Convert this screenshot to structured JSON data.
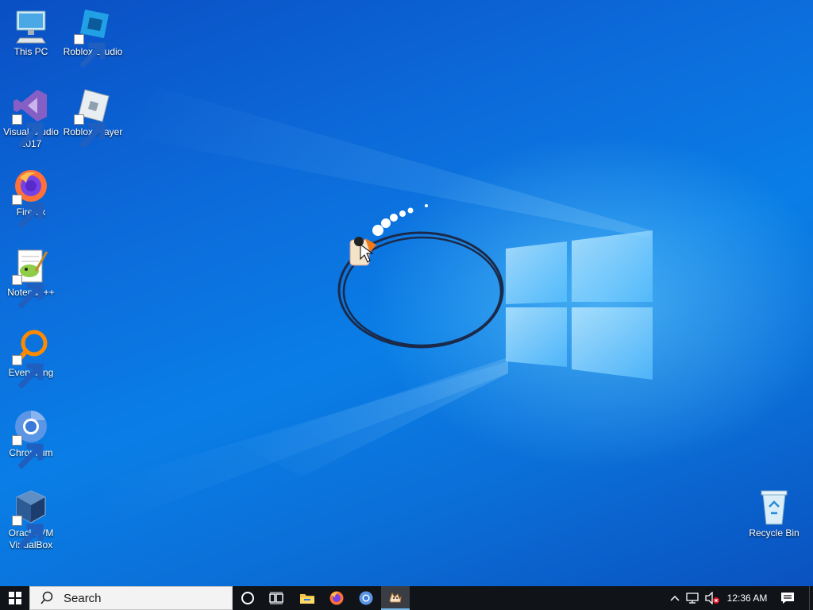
{
  "desktop_icons": [
    {
      "label": "This PC",
      "icon": "computer-icon"
    },
    {
      "label": "Roblox Studio",
      "icon": "roblox-studio-icon"
    },
    {
      "label": "Visual Studio 2017",
      "icon": "visual-studio-icon"
    },
    {
      "label": "Roblox Player",
      "icon": "roblox-player-icon"
    },
    {
      "label": "Firefox",
      "icon": "firefox-icon"
    },
    {
      "label": "Notepad++",
      "icon": "notepad-plus-plus-icon"
    },
    {
      "label": "Everything",
      "icon": "everything-search-icon"
    },
    {
      "label": "Chromium",
      "icon": "chromium-icon"
    },
    {
      "label": "Oracle VM VirtualBox",
      "icon": "virtualbox-icon"
    },
    {
      "label": "Recycle Bin",
      "icon": "recycle-bin-icon"
    }
  ],
  "taskbar": {
    "search_placeholder": "Search",
    "pinned": [
      {
        "name": "cortana",
        "icon": "cortana-circle-icon"
      },
      {
        "name": "task-view",
        "icon": "task-view-icon"
      },
      {
        "name": "file-explorer",
        "icon": "folder-icon"
      },
      {
        "name": "firefox",
        "icon": "firefox-icon"
      },
      {
        "name": "chromium",
        "icon": "chromium-icon"
      },
      {
        "name": "running-app",
        "icon": "cat-app-icon",
        "active": true
      }
    ],
    "tray": {
      "overflow_icon": "chevron-up-icon",
      "network_icon": "network-icon",
      "volume_icon": "volume-muted-icon"
    },
    "clock": "12:36 AM",
    "notification_icon": "action-center-icon"
  },
  "colors": {
    "desktop_blue": "#0a6fdc",
    "taskbar": "#101318",
    "accent": "#76b9ed"
  }
}
